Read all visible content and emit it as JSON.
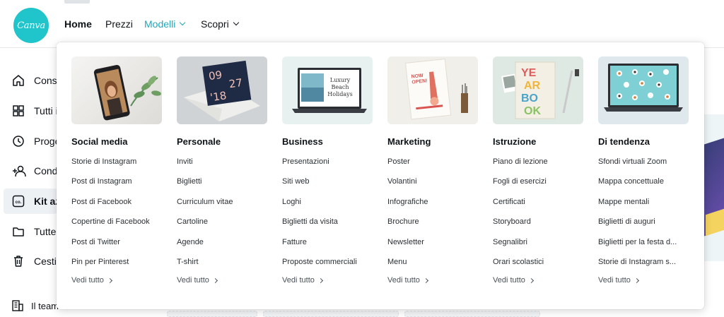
{
  "brand": {
    "logo_text": "Canva",
    "color": "#20c4cb"
  },
  "nav": {
    "home": "Home",
    "prices": "Prezzi",
    "models": "Modelli",
    "discover": "Scopri"
  },
  "sidebar": {
    "items": [
      {
        "label": "Consi",
        "icon": "home-icon"
      },
      {
        "label": "Tutti i",
        "icon": "grid-icon"
      },
      {
        "label": "Proge",
        "icon": "clock-icon"
      },
      {
        "label": "Condi",
        "icon": "people-add-icon"
      },
      {
        "label": "Kit az",
        "icon": "brand-kit-icon"
      },
      {
        "label": "Tutte",
        "icon": "folder-icon"
      },
      {
        "label": "Cestin",
        "icon": "trash-icon"
      }
    ],
    "team": "Il team"
  },
  "menu": {
    "see_all": "Vedi tutto",
    "columns": [
      {
        "title": "Social media",
        "links": [
          "Storie di Instagram",
          "Post di Instagram",
          "Post di Facebook",
          "Copertine di Facebook",
          "Post di Twitter",
          "Pin per Pinterest"
        ]
      },
      {
        "title": "Personale",
        "thumb_text": [
          "09",
          "27",
          "'18"
        ],
        "links": [
          "Inviti",
          "Biglietti",
          "Curriculum vitae",
          "Cartoline",
          "Agende",
          "T-shirt"
        ]
      },
      {
        "title": "Business",
        "thumb_text": [
          "Luxury",
          "Beach",
          "Holidays"
        ],
        "links": [
          "Presentazioni",
          "Siti web",
          "Loghi",
          "Biglietti da visita",
          "Fatture",
          "Proposte commerciali"
        ]
      },
      {
        "title": "Marketing",
        "thumb_text": [
          "NOW",
          "OPEN!"
        ],
        "links": [
          "Poster",
          "Volantini",
          "Infografiche",
          "Brochure",
          "Newsletter",
          "Menu"
        ]
      },
      {
        "title": "Istruzione",
        "thumb_text": [
          "YE",
          "AR",
          "BO",
          "OK"
        ],
        "links": [
          "Piano di lezione",
          "Fogli di esercizi",
          "Certificati",
          "Storyboard",
          "Segnalibri",
          "Orari scolastici"
        ]
      },
      {
        "title": "Di tendenza",
        "links": [
          "Sfondi virtuali Zoom",
          "Mappa concettuale",
          "Mappe mentali",
          "Biglietti di auguri",
          "Biglietti per la festa d...",
          "Storie di Instagram s..."
        ]
      }
    ]
  }
}
